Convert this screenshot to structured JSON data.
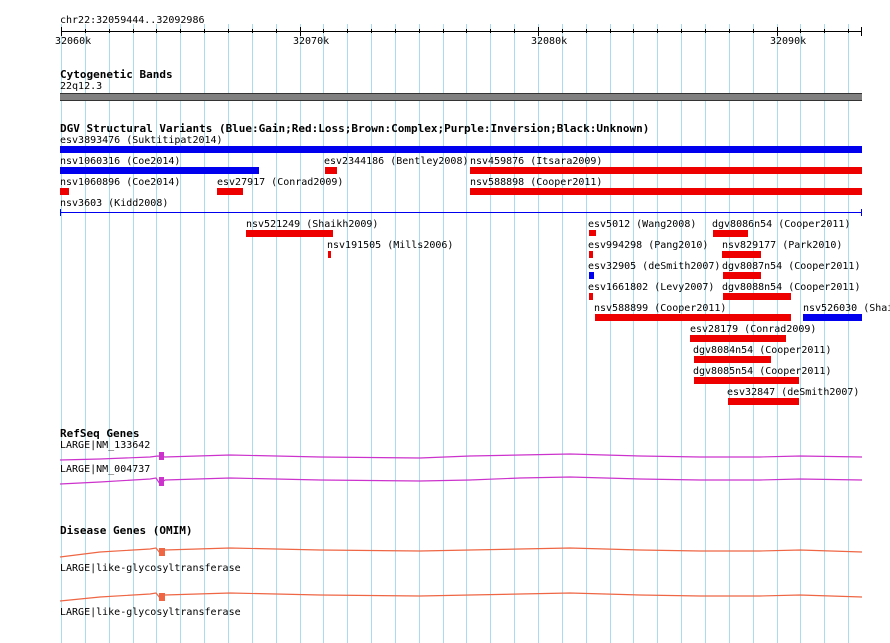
{
  "ruler": {
    "coords": "chr22:32059444..32092986",
    "ticks": [
      "32060k",
      "32070k",
      "32080k",
      "32090k"
    ]
  },
  "cytoband": {
    "title": "Cytogenetic Bands",
    "band": "22q12.3",
    "color": "#808080"
  },
  "dgv": {
    "title": "DGV Structural Variants (Blue:Gain;Red:Loss;Brown:Complex;Purple:Inversion;Black:Unknown)",
    "colors": {
      "gain": "#0000ee",
      "loss": "#ee0000"
    },
    "variants": [
      {
        "label": "esv3893476 (Suktitipat2014)",
        "type": "gain"
      },
      {
        "label": "nsv1060316 (Coe2014)",
        "type": "gain"
      },
      {
        "label": "esv2344186 (Bentley2008)",
        "type": "loss"
      },
      {
        "label": "nsv459876 (Itsara2009)",
        "type": "loss"
      },
      {
        "label": "nsv1060896 (Coe2014)",
        "type": "loss"
      },
      {
        "label": "esv27917 (Conrad2009)",
        "type": "loss"
      },
      {
        "label": "nsv588898 (Cooper2011)",
        "type": "loss"
      },
      {
        "label": "nsv3603 (Kidd2008)",
        "type": "gain"
      },
      {
        "label": "nsv521249 (Shaikh2009)",
        "type": "loss"
      },
      {
        "label": "esv5012 (Wang2008)",
        "type": "loss"
      },
      {
        "label": "dgv8086n54 (Cooper2011)",
        "type": "loss"
      },
      {
        "label": "nsv191505 (Mills2006)",
        "type": "loss"
      },
      {
        "label": "esv994298 (Pang2010)",
        "type": "loss"
      },
      {
        "label": "nsv829177 (Park2010)",
        "type": "loss"
      },
      {
        "label": "esv32905 (deSmith2007)",
        "type": "gain"
      },
      {
        "label": "dgv8087n54 (Cooper2011)",
        "type": "loss"
      },
      {
        "label": "esv1661802 (Levy2007)",
        "type": "loss"
      },
      {
        "label": "dgv8088n54 (Cooper2011)",
        "type": "loss"
      },
      {
        "label": "nsv588899 (Cooper2011)",
        "type": "loss"
      },
      {
        "label": "nsv526030 (Shai",
        "type": "gain"
      },
      {
        "label": "esv28179 (Conrad2009)",
        "type": "loss"
      },
      {
        "label": "dgv8084n54 (Cooper2011)",
        "type": "loss"
      },
      {
        "label": "dgv8085n54 (Cooper2011)",
        "type": "loss"
      },
      {
        "label": "esv32847 (deSmith2007)",
        "type": "loss"
      }
    ]
  },
  "refseq": {
    "title": "RefSeq Genes",
    "color": "#cc33cc",
    "genes": [
      "LARGE|NM_133642",
      "LARGE|NM_004737"
    ]
  },
  "omim": {
    "title": "Disease Genes (OMIM)",
    "color": "#ee6644",
    "genes": [
      "LARGE|like-glycosyltransferase",
      "LARGE|like-glycosyltransferase"
    ]
  }
}
